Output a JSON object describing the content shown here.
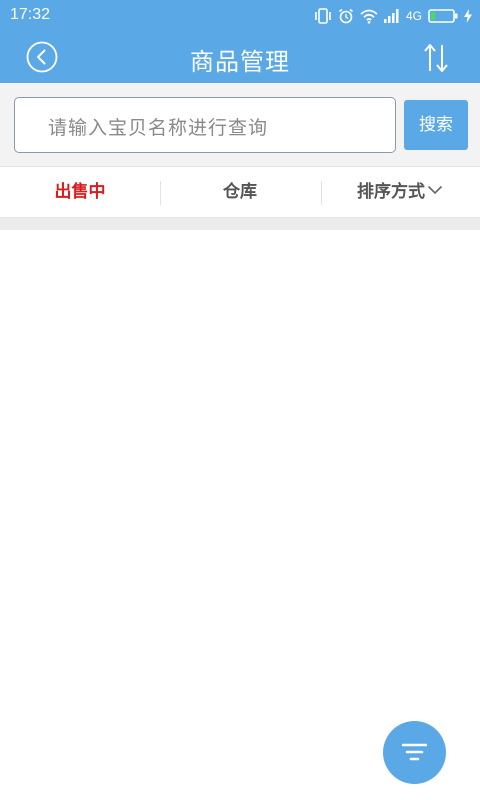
{
  "status_bar": {
    "time": "17:32",
    "network_label": "4G",
    "icons": [
      "vibrate-icon",
      "alarm-icon",
      "wifi-icon",
      "signal-icon",
      "battery-icon",
      "charging-icon"
    ],
    "battery_level": 0.2
  },
  "app_bar": {
    "title": "商品管理",
    "back_icon": "back-circle-icon",
    "sort_icon": "sort-arrows-icon"
  },
  "search": {
    "placeholder": "请输入宝贝名称进行查询",
    "button_label": "搜索"
  },
  "tabs": {
    "selling": "出售中",
    "warehouse": "仓库",
    "sort": "排序方式"
  },
  "fab": {
    "icon": "filter-icon"
  },
  "colors": {
    "primary": "#5aa9e6",
    "active_tab": "#d81e1e",
    "tab_text": "#555555",
    "background": "#ffffff"
  }
}
